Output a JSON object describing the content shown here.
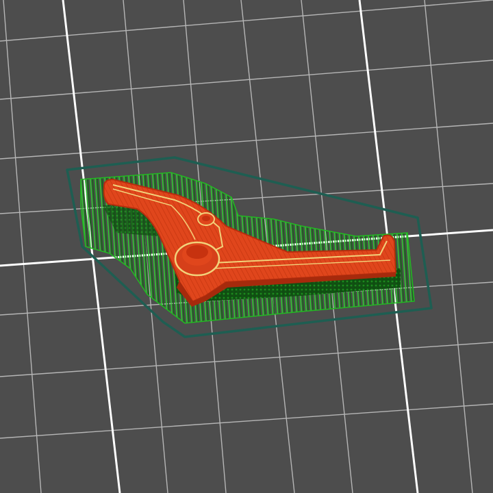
{
  "scene": {
    "view": "slicer-layer-preview",
    "plate_color": "#4d4d4d",
    "minor_grid_color": "#c9c9c9",
    "major_grid_color": "#ffffff",
    "skirt_color": "#1e5e52",
    "support_color": "#22b922",
    "support_dark_color": "#0f6a12",
    "model_infill_color": "#e0461c",
    "model_wall_color": "#c7320f",
    "model_outline_color": "#f2d27a"
  }
}
